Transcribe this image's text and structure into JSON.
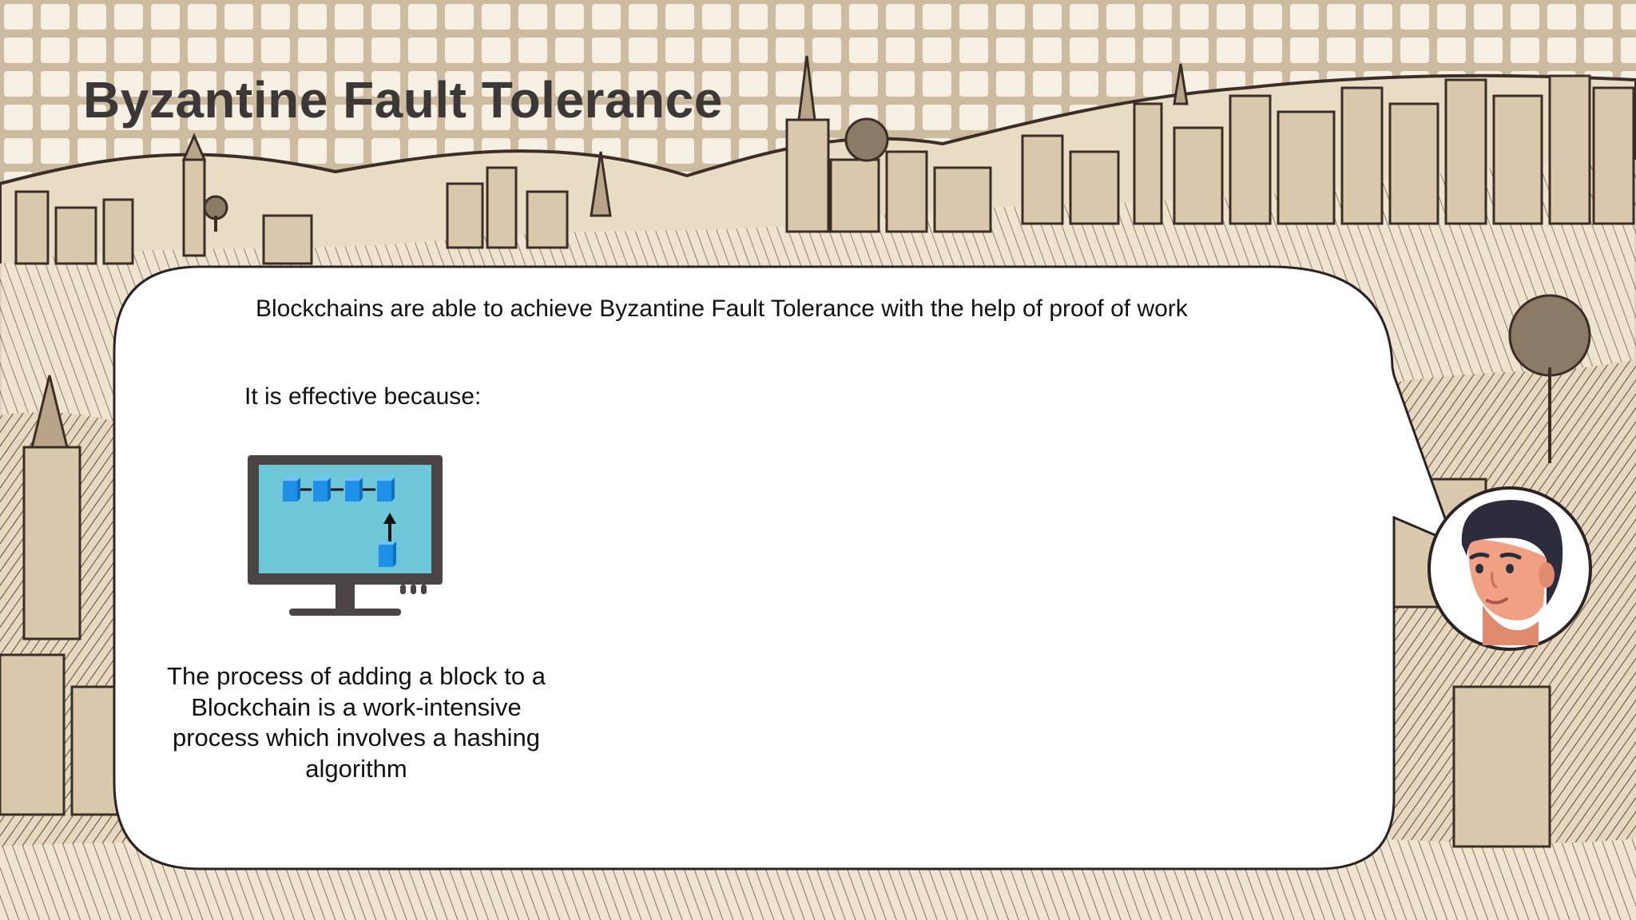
{
  "slide": {
    "title": "Byzantine Fault Tolerance",
    "lead": "Blockchains are able to achieve Byzantine Fault Tolerance with the help of proof of work",
    "subheading": "It is effective because:",
    "caption": "The process of adding a block to a Blockchain is a work-intensive process which involves a hashing algorithm"
  },
  "illustration": {
    "icon": "blockchain-monitor-icon",
    "block_count_in_chain": 4
  },
  "presenter": {
    "icon": "presenter-avatar-icon"
  },
  "colors": {
    "title": "#3c3838",
    "background": "#ece0cc",
    "bubble": "#ffffff",
    "screen": "#6ec6d9",
    "block": "#1e90e8",
    "monitor_frame": "#4a4444"
  }
}
